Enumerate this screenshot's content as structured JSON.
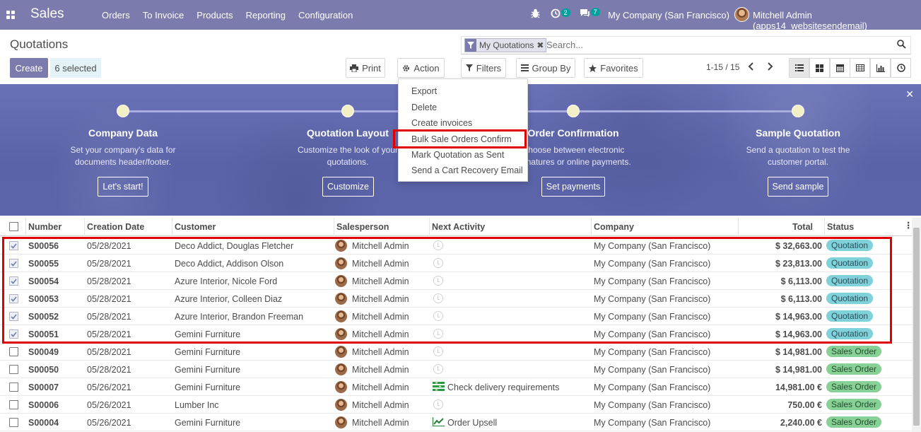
{
  "navbar": {
    "brand": "Sales",
    "menu": [
      "Orders",
      "To Invoice",
      "Products",
      "Reporting",
      "Configuration"
    ],
    "activity_count": "2",
    "messages_count": "7",
    "company": "My Company (San Francisco)",
    "user": "Mitchell Admin (apps14_websitesendemail)"
  },
  "control_panel": {
    "title": "Quotations",
    "create_label": "Create",
    "selected_label": "6 selected",
    "print_label": "Print",
    "action_label": "Action",
    "filters_label": "Filters",
    "groupby_label": "Group By",
    "favorites_label": "Favorites",
    "facet_label": "My Quotations",
    "search_placeholder": "Search...",
    "pager": "1-15 / 15"
  },
  "action_menu": {
    "items": [
      "Export",
      "Delete",
      "Create invoices",
      "Bulk Sale Orders Confirm",
      "Mark Quotation as Sent",
      "Send a Cart Recovery Email"
    ],
    "highlighted": "Bulk Sale Orders Confirm"
  },
  "banner": {
    "steps": [
      {
        "title": "Company Data",
        "desc1": "Set your company's data for",
        "desc2": "documents header/footer.",
        "button": "Let's start!"
      },
      {
        "title": "Quotation Layout",
        "desc1": "Customize the look of your",
        "desc2": "quotations.",
        "button": "Customize"
      },
      {
        "title": "Order Confirmation",
        "desc1": "Choose between electronic",
        "desc2": "signatures or online payments.",
        "button": "Set payments"
      },
      {
        "title": "Sample Quotation",
        "desc1": "Send a quotation to test the",
        "desc2": "customer portal.",
        "button": "Send sample"
      }
    ]
  },
  "table": {
    "headers": [
      "Number",
      "Creation Date",
      "Customer",
      "Salesperson",
      "Next Activity",
      "Company",
      "Total",
      "Status"
    ],
    "rows": [
      {
        "number": "S00056",
        "date": "05/28/2021",
        "customer": "Deco Addict, Douglas Fletcher",
        "salesperson": "Mitchell Admin",
        "activity": "",
        "company": "My Company (San Francisco)",
        "total": "$ 32,663.00",
        "status": "Quotation",
        "checked": true
      },
      {
        "number": "S00055",
        "date": "05/28/2021",
        "customer": "Deco Addict, Addison Olson",
        "salesperson": "Mitchell Admin",
        "activity": "",
        "company": "My Company (San Francisco)",
        "total": "$ 23,813.00",
        "status": "Quotation",
        "checked": true
      },
      {
        "number": "S00054",
        "date": "05/28/2021",
        "customer": "Azure Interior, Nicole Ford",
        "salesperson": "Mitchell Admin",
        "activity": "",
        "company": "My Company (San Francisco)",
        "total": "$ 6,113.00",
        "status": "Quotation",
        "checked": true
      },
      {
        "number": "S00053",
        "date": "05/28/2021",
        "customer": "Azure Interior, Colleen Diaz",
        "salesperson": "Mitchell Admin",
        "activity": "",
        "company": "My Company (San Francisco)",
        "total": "$ 6,113.00",
        "status": "Quotation",
        "checked": true
      },
      {
        "number": "S00052",
        "date": "05/28/2021",
        "customer": "Azure Interior, Brandon Freeman",
        "salesperson": "Mitchell Admin",
        "activity": "",
        "company": "My Company (San Francisco)",
        "total": "$ 14,963.00",
        "status": "Quotation",
        "checked": true
      },
      {
        "number": "S00051",
        "date": "05/28/2021",
        "customer": "Gemini Furniture",
        "salesperson": "Mitchell Admin",
        "activity": "",
        "company": "My Company (San Francisco)",
        "total": "$ 14,963.00",
        "status": "Quotation",
        "checked": true
      },
      {
        "number": "S00049",
        "date": "05/28/2021",
        "customer": "Gemini Furniture",
        "salesperson": "Mitchell Admin",
        "activity": "",
        "company": "My Company (San Francisco)",
        "total": "$ 14,981.00",
        "status": "Sales Order",
        "checked": false
      },
      {
        "number": "S00050",
        "date": "05/28/2021",
        "customer": "Gemini Furniture",
        "salesperson": "Mitchell Admin",
        "activity": "",
        "company": "My Company (San Francisco)",
        "total": "$ 14,981.00",
        "status": "Sales Order",
        "checked": false
      },
      {
        "number": "S00007",
        "date": "05/26/2021",
        "customer": "Gemini Furniture",
        "salesperson": "Mitchell Admin",
        "activity": "Check delivery requirements",
        "company": "My Company (San Francisco)",
        "total": "14,981.00 €",
        "status": "Sales Order",
        "checked": false
      },
      {
        "number": "S00006",
        "date": "05/26/2021",
        "customer": "Lumber Inc",
        "salesperson": "Mitchell Admin",
        "activity": "",
        "company": "My Company (San Francisco)",
        "total": "750.00 €",
        "status": "Sales Order",
        "checked": false
      },
      {
        "number": "S00004",
        "date": "05/26/2021",
        "customer": "Gemini Furniture",
        "salesperson": "Mitchell Admin",
        "activity": "Order Upsell",
        "company": "My Company (San Francisco)",
        "total": "2,240.00 €",
        "status": "Sales Order",
        "checked": false
      }
    ]
  },
  "colors": {
    "brand": "#7c7bad",
    "quotation_badge": "#7fd1da",
    "sales_order_badge": "#88d196",
    "highlight": "#e00000"
  }
}
